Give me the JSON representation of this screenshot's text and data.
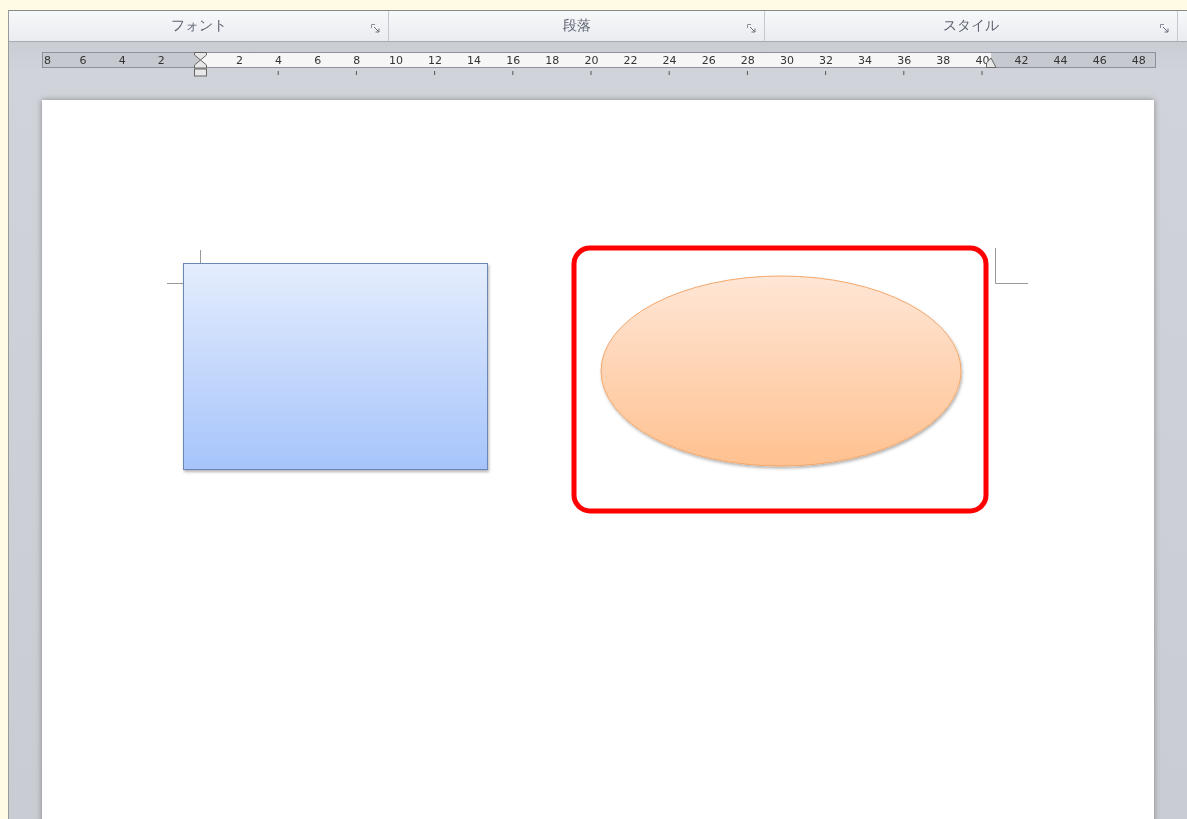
{
  "ribbon_groups": [
    {
      "label": "フォント"
    },
    {
      "label": "段落"
    },
    {
      "label": "スタイル"
    }
  ],
  "ruler": {
    "labels": [
      "8",
      "6",
      "4",
      "2",
      "2",
      "4",
      "6",
      "8",
      "10",
      "12",
      "14",
      "16",
      "18",
      "20",
      "22",
      "24",
      "26",
      "28",
      "30",
      "32",
      "34",
      "36",
      "38",
      "40",
      "42",
      "44",
      "46",
      "48"
    ]
  },
  "document": {
    "shapes": [
      {
        "kind": "rectangle",
        "highlighted": false
      },
      {
        "kind": "ellipse",
        "highlighted": true
      }
    ]
  }
}
